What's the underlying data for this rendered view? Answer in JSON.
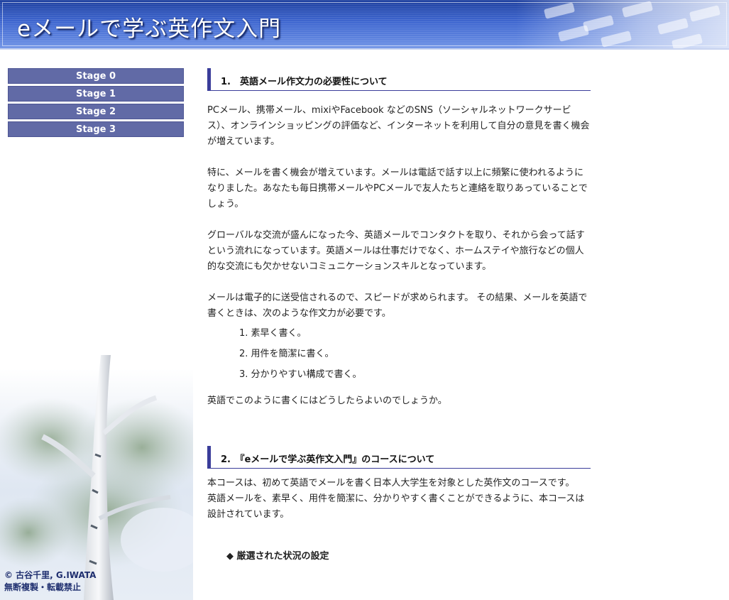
{
  "header": {
    "title": "eメールで学ぶ英作文入門"
  },
  "nav": {
    "items": [
      {
        "label": "Stage 0"
      },
      {
        "label": "Stage 1"
      },
      {
        "label": "Stage 2"
      },
      {
        "label": "Stage 3"
      }
    ]
  },
  "footer": {
    "copyright": "© 古谷千里, G.IWATA",
    "notice": "無断複製・転載禁止"
  },
  "section1": {
    "heading": "1.　英語メール作文力の必要性について",
    "p1": "PCメール、携帯メール、mixiやFacebook などのSNS（ソーシャルネットワークサービス）、オンラインショッピングの評価など、インターネットを利用して自分の意見を書く機会が増えています。",
    "p2": "特に、メールを書く機会が増えています。メールは電話で話す以上に頻繁に使われるようになりました。あなたも毎日携帯メールやPCメールで友人たちと連絡を取りあっていることでしょう。",
    "p3": "グローバルな交流が盛んになった今、英語メールでコンタクトを取り、それから会って話すという流れになっています。英語メールは仕事だけでなく、ホームステイや旅行などの個人的な交流にも欠かせないコミュニケーションスキルとなっています。",
    "p4": "メールは電子的に送受信されるので、スピードが求められます。 その結果、メールを英語で書くときは、次のような作文力が必要です。",
    "list": [
      "1. 素早く書く。",
      "2. 用件を簡潔に書く。",
      "3. 分かりやすい構成で書く。"
    ],
    "p5": "英語でこのように書くにはどうしたらよいのでしょうか。"
  },
  "section2": {
    "heading": "2.　『eメールで学ぶ英作文入門』のコースについて",
    "p1": "本コースは、初めて英語でメールを書く日本人大学生を対象とした英作文のコースです。",
    "p2": "英語メールを、素早く、用件を簡潔に、分かりやすく書くことができるように、本コースは設計されています。",
    "sub": "◆ 厳選された状況の設定"
  }
}
